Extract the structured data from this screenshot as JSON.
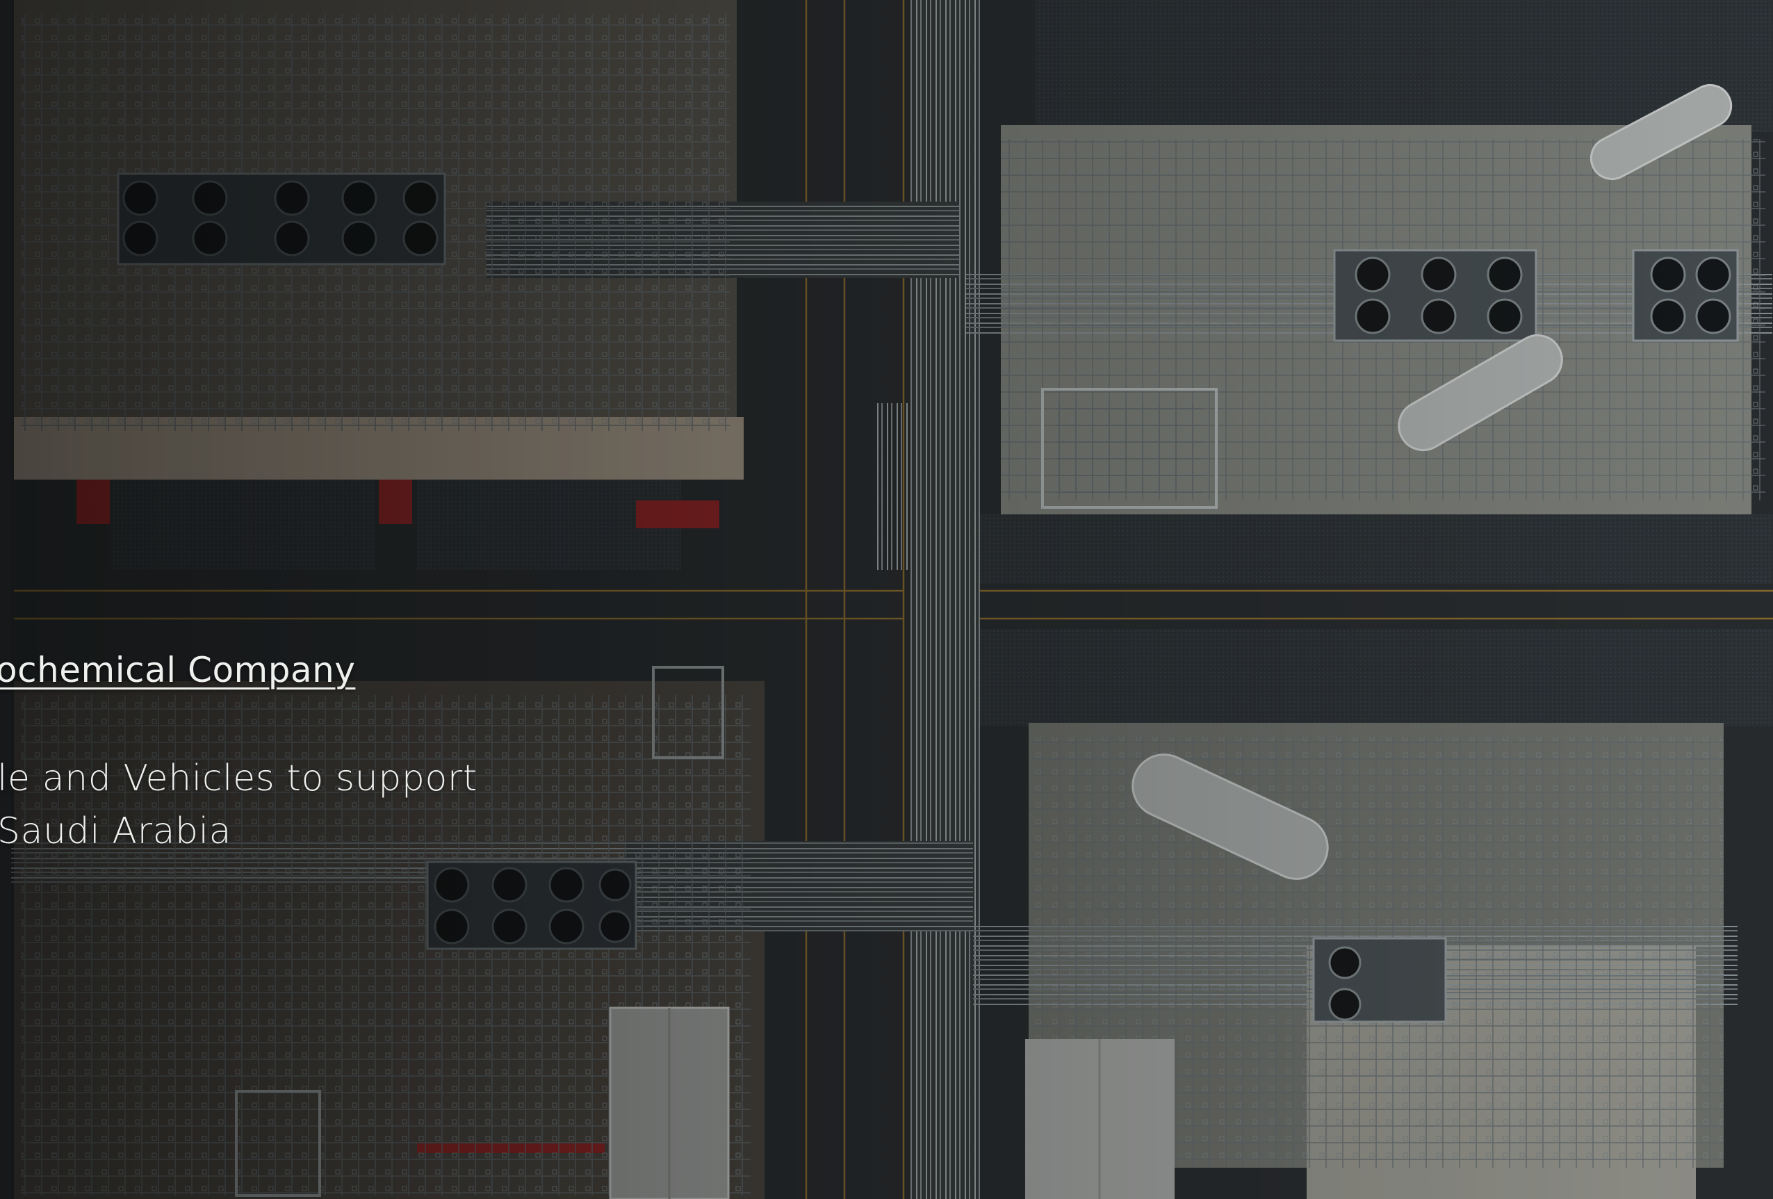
{
  "hero": {
    "company_link_text": "ochemical Company",
    "description_line_1": "le and Vehicles to support",
    "description_line_2": "Saudi Arabia"
  }
}
